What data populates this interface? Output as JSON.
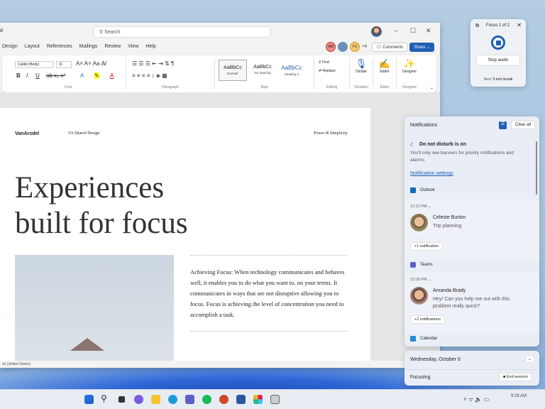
{
  "word": {
    "app_menu": "d",
    "search_placeholder": "Search",
    "tabs": [
      "Design",
      "Layout",
      "References",
      "Mailings",
      "Review",
      "View",
      "Help"
    ],
    "collaborators": [
      "MM",
      "",
      "FS"
    ],
    "extra_collaborators": "+4",
    "comments_label": "Comments",
    "share_label": "Share",
    "font_name": "Calibri (Body)",
    "font_size": "11",
    "styles": [
      {
        "preview": "AaBbCc",
        "name": "Normal*"
      },
      {
        "preview": "AaBbCc",
        "name": "No Spacing"
      },
      {
        "preview": "AaBbCc",
        "name": "Heading 1"
      }
    ],
    "find_label": "Find",
    "replace_label": "Replace",
    "dictate_label": "Dictate",
    "editor_label": "Editor",
    "designer_label": "Designer",
    "group_labels": {
      "font": "Font",
      "paragraph": "Paragraph",
      "style": "Style",
      "editing": "Editing",
      "dictation": "Dictation",
      "editor": "Editor",
      "designer": "Designer"
    },
    "status_language": "sh (United States)"
  },
  "document": {
    "logo": "VanArsdel",
    "header_center": "VA Shared Design",
    "header_right": "Power & Simplicity",
    "headline_1": "Experiences",
    "headline_2": "built for focus",
    "body": "Achieving Focus: When technology communicates and behaves well, it enables you to do what you want to, on your terms. It communicates in ways that are not disruptive allowing you to focus. Focus is achieving the level of concentration you need to accomplish a task."
  },
  "focus_widget": {
    "title": "Focus 1 of 2",
    "stop_audio": "Stop audio",
    "next_prefix": "Next:",
    "next_value": "5 min break"
  },
  "notifications": {
    "title": "Notifications",
    "clear_all": "Clear all",
    "dnd_title": "Do not disturb is on",
    "dnd_text": "You'll only see banners for priority notifications and alarms.",
    "settings_link": "Notification settings",
    "groups": [
      {
        "app": "Outlook",
        "time": "12:12 PM",
        "sender": "Celeste Burton",
        "message": "Trip planning",
        "more": "+1 notification"
      },
      {
        "app": "Teams",
        "time": "12:05 PM",
        "sender": "Amanda Brady",
        "message": "Hey! Can you help me out with this problem really quick?",
        "more": "+2 notifications"
      },
      {
        "app": "Calendar"
      }
    ]
  },
  "calendar": {
    "date": "Wednesday, October 6",
    "focusing": "Focusing",
    "end_session": "End session"
  },
  "taskbar": {
    "time": "9:28 AM",
    "colors": {
      "accent": "#1f5fb4"
    }
  }
}
